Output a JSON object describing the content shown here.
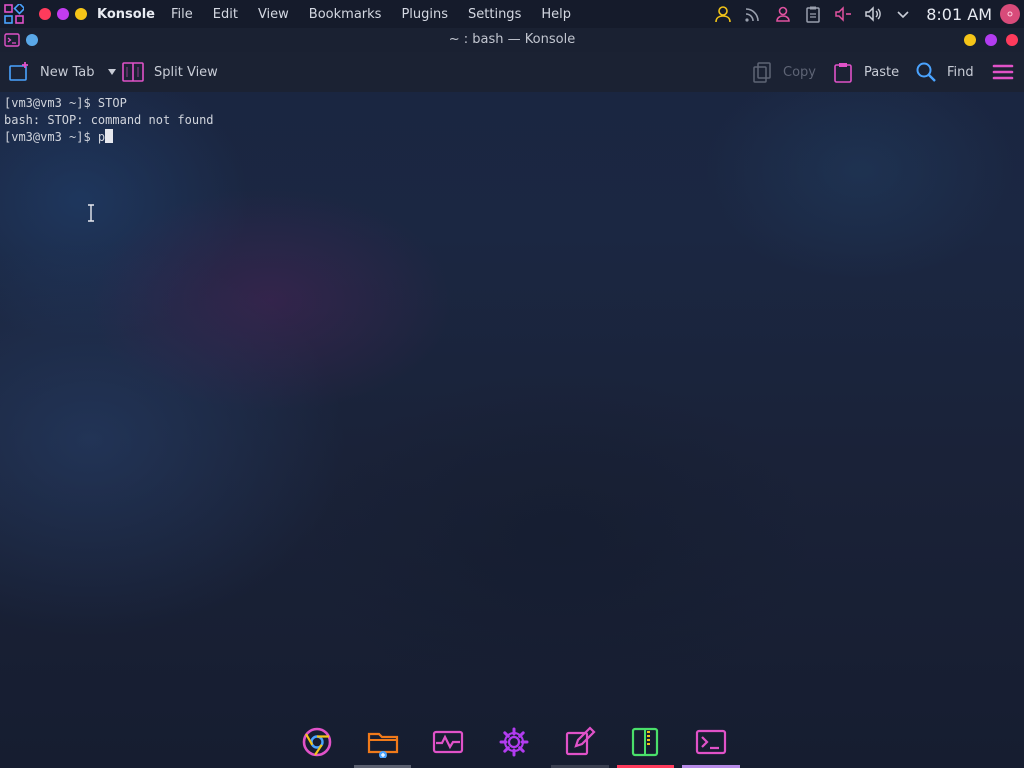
{
  "panel": {
    "app_name": "Konsole",
    "menu": [
      "File",
      "Edit",
      "View",
      "Bookmarks",
      "Plugins",
      "Settings",
      "Help"
    ],
    "tray_icons": [
      "user-icon",
      "rss-icon",
      "contacts-icon",
      "clipboard-icon",
      "volume-mute-icon",
      "volume-icon",
      "chevron-down-icon"
    ],
    "clock": "8:01 AM"
  },
  "window": {
    "title": "~ : bash — Konsole"
  },
  "toolbar": {
    "new_tab": "New Tab",
    "split_view": "Split View",
    "copy": "Copy",
    "paste": "Paste",
    "find": "Find"
  },
  "terminal": {
    "lines": [
      "[vm3@vm3 ~]$ STOP",
      "bash: STOP: command not found"
    ],
    "prompt": "[vm3@vm3 ~]$ ",
    "current_input": "p"
  },
  "dock": {
    "apps": [
      "chrome-icon",
      "files-icon",
      "system-monitor-icon",
      "settings-icon",
      "text-editor-icon",
      "archive-icon",
      "terminal-icon"
    ]
  },
  "colors": {
    "accent_pink": "#e052c8",
    "accent_blue": "#4aa3ff",
    "accent_yellow": "#f2c418",
    "close_red": "#ff3b5c",
    "min_yellow": "#f5c518",
    "max_purple": "#b23cf0"
  }
}
